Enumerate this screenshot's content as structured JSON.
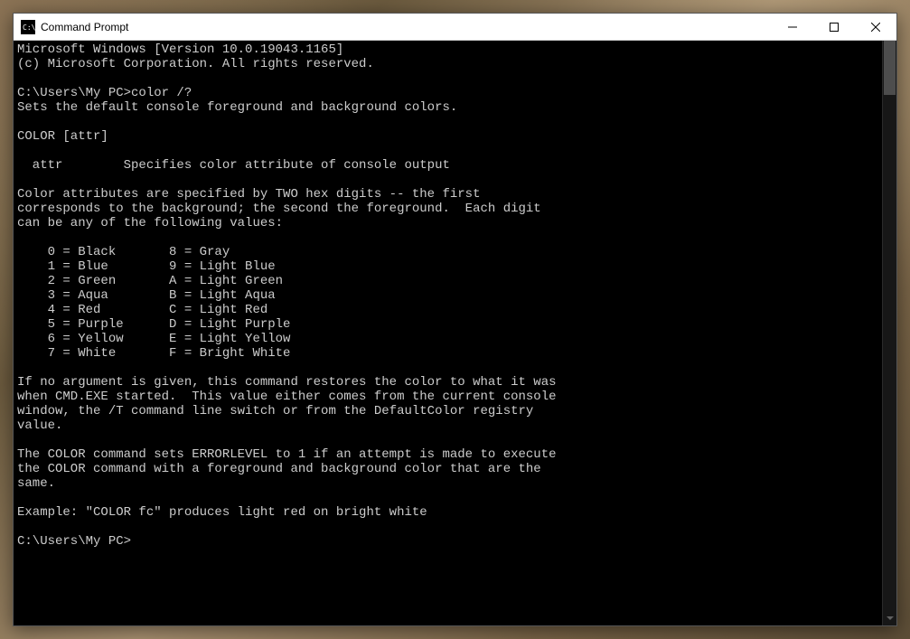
{
  "window": {
    "title": "Command Prompt"
  },
  "console": {
    "line1": "Microsoft Windows [Version 10.0.19043.1165]",
    "line2": "(c) Microsoft Corporation. All rights reserved.",
    "blank1": "",
    "prompt1": "C:\\Users\\My PC>color /?",
    "help1": "Sets the default console foreground and background colors.",
    "blank2": "",
    "syntax": "COLOR [attr]",
    "blank3": "",
    "attr_desc": "  attr        Specifies color attribute of console output",
    "blank4": "",
    "spec1": "Color attributes are specified by TWO hex digits -- the first",
    "spec2": "corresponds to the background; the second the foreground.  Each digit",
    "spec3": "can be any of the following values:",
    "blank5": "",
    "c0": "    0 = Black       8 = Gray",
    "c1": "    1 = Blue        9 = Light Blue",
    "c2": "    2 = Green       A = Light Green",
    "c3": "    3 = Aqua        B = Light Aqua",
    "c4": "    4 = Red         C = Light Red",
    "c5": "    5 = Purple      D = Light Purple",
    "c6": "    6 = Yellow      E = Light Yellow",
    "c7": "    7 = White       F = Bright White",
    "blank6": "",
    "noarg1": "If no argument is given, this command restores the color to what it was",
    "noarg2": "when CMD.EXE started.  This value either comes from the current console",
    "noarg3": "window, the /T command line switch or from the DefaultColor registry",
    "noarg4": "value.",
    "blank7": "",
    "err1": "The COLOR command sets ERRORLEVEL to 1 if an attempt is made to execute",
    "err2": "the COLOR command with a foreground and background color that are the",
    "err3": "same.",
    "blank8": "",
    "example": "Example: \"COLOR fc\" produces light red on bright white",
    "blank9": "",
    "prompt2": "C:\\Users\\My PC>"
  }
}
